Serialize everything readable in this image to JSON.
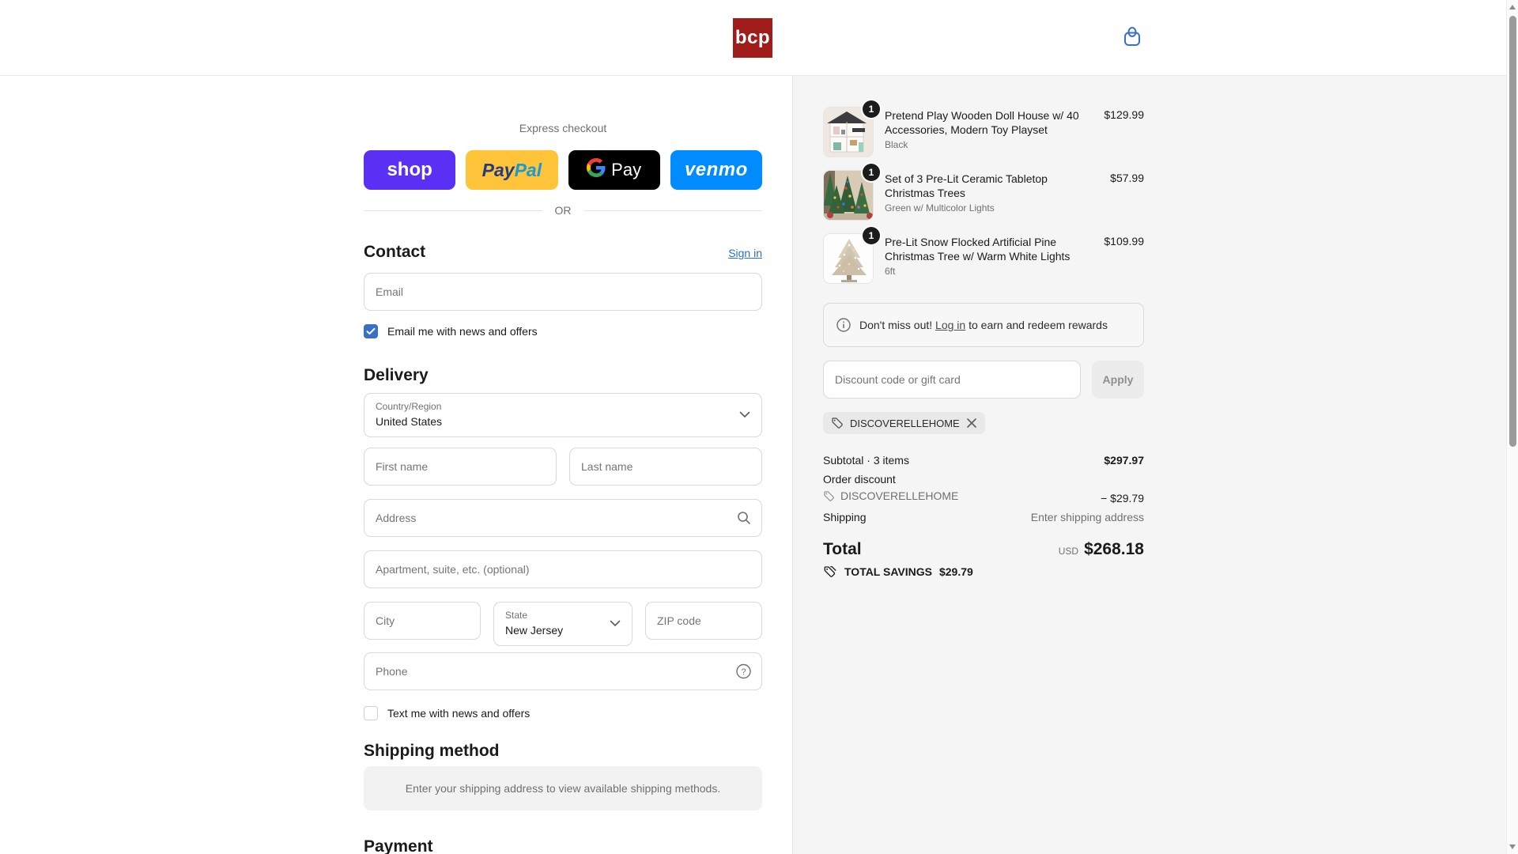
{
  "header": {
    "logo_text": "bcp",
    "brand_color": "#9f1c1a",
    "accent_blue": "#3a70c4"
  },
  "express": {
    "title": "Express checkout",
    "divider": "OR",
    "shop_label": "shop",
    "paypal_pay": "Pay",
    "paypal_pal": "Pal",
    "gpay_label": "Pay",
    "venmo_label": "venmo",
    "colors": {
      "shop": "#5a31f4",
      "paypal": "#ffc439",
      "gpay": "#000000",
      "venmo": "#008cff"
    }
  },
  "contact": {
    "heading": "Contact",
    "signin_label": "Sign in",
    "email_placeholder": "Email",
    "news_label": "Email me with news and offers",
    "news_checked": true
  },
  "delivery": {
    "heading": "Delivery",
    "country_label": "Country/Region",
    "country_value": "United States",
    "first_name_placeholder": "First name",
    "last_name_placeholder": "Last name",
    "address_placeholder": "Address",
    "apartment_placeholder": "Apartment, suite, etc. (optional)",
    "city_placeholder": "City",
    "state_label": "State",
    "state_value": "New Jersey",
    "zip_placeholder": "ZIP code",
    "phone_placeholder": "Phone",
    "sms_label": "Text me with news and offers",
    "sms_checked": false
  },
  "shipping_method": {
    "heading": "Shipping method",
    "notice": "Enter your shipping address to view available shipping methods."
  },
  "payment": {
    "heading": "Payment"
  },
  "order_summary": {
    "items": [
      {
        "qty": "1",
        "title": "Pretend Play Wooden Doll House w/ 40 Accessories, Modern Toy Playset",
        "variant": "Black",
        "price": "$129.99"
      },
      {
        "qty": "1",
        "title": "Set of 3 Pre-Lit Ceramic Tabletop Christmas Trees",
        "variant": "Green w/ Multicolor Lights",
        "price": "$57.99"
      },
      {
        "qty": "1",
        "title": "Pre-Lit Snow Flocked Artificial Pine Christmas Tree w/ Warm White Lights",
        "variant": "6ft",
        "price": "$109.99"
      }
    ],
    "rewards_banner": {
      "pre": "Don't miss out!",
      "link": "Log in",
      "post": "to earn and redeem rewards"
    },
    "discount": {
      "placeholder": "Discount code or gift card",
      "apply_label": "Apply",
      "applied_code": "DISCOVERELLEHOME"
    },
    "totals": {
      "subtotal_label": "Subtotal · 3 items",
      "subtotal_value": "$297.97",
      "discount_label": "Order discount",
      "discount_code": "DISCOVERELLEHOME",
      "discount_value": "− $29.79",
      "shipping_label": "Shipping",
      "shipping_value": "Enter shipping address",
      "total_label": "Total",
      "currency": "USD",
      "total_value": "$268.18",
      "savings_label": "TOTAL SAVINGS",
      "savings_value": "$29.79"
    }
  }
}
